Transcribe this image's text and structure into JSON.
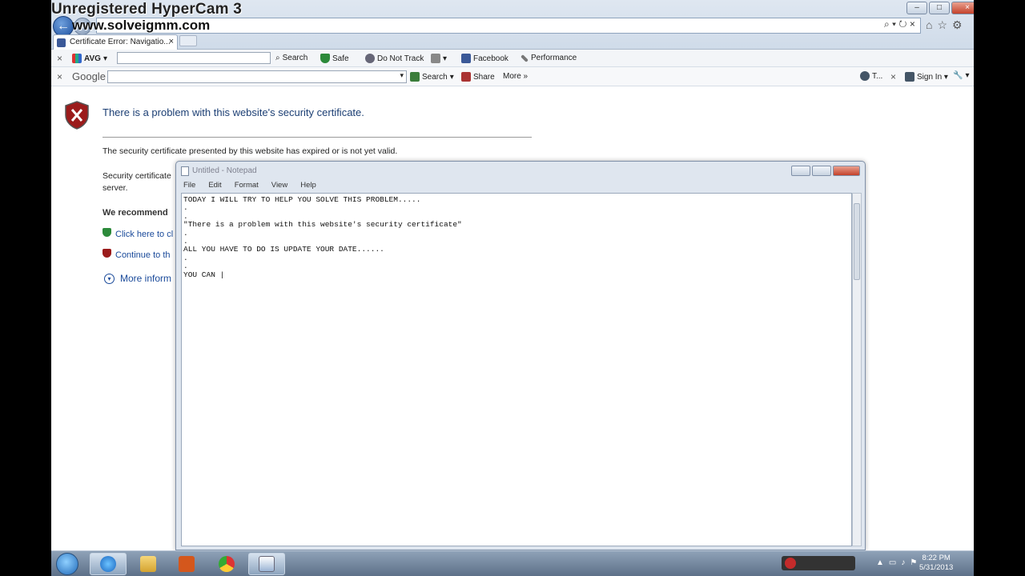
{
  "watermark": {
    "line1": "Unregistered HyperCam 3",
    "line2": "www.solveigmm.com"
  },
  "browser": {
    "tab_title": "Certificate Error: Navigatio...",
    "tab_close": "×",
    "address_tools": "⌕ ▾ ↻ ×",
    "right_icons": [
      "⌂",
      "☆",
      "⚙"
    ]
  },
  "toolbar1": {
    "close": "×",
    "avg_label": "AVG",
    "search": "Search",
    "safe": "Safe",
    "do_not_track": "Do Not Track",
    "facebook": "Facebook",
    "performance": "Performance"
  },
  "toolbar2": {
    "close": "×",
    "google_label": "Google",
    "search": "Search",
    "share": "Share",
    "more": "More »",
    "t_label": "T...",
    "sign_in": "Sign In ▾"
  },
  "page": {
    "title": "There is a problem with this website's security certificate.",
    "text1": "The security certificate presented by this website has expired or is not yet valid.",
    "text2_line1": "Security certificate",
    "text2_line2": "server.",
    "recommend": "We recommend",
    "link1": "Click here to cl",
    "link2": "Continue to th",
    "more_info": "More inform"
  },
  "notepad": {
    "title": "Untitled - Notepad",
    "menu": [
      "File",
      "Edit",
      "Format",
      "View",
      "Help"
    ],
    "content": "TODAY I WILL TRY TO HELP YOU SOLVE THIS PROBLEM.....\n.\n.\n\"There is a problem with this website's security certificate\"\n.\n.\nALL YOU HAVE TO DO IS UPDATE YOUR DATE......\n.\n.\nYOU CAN |"
  },
  "clock": {
    "time": "8:22 PM",
    "date": "5/31/2013"
  },
  "colors": {
    "link": "#1a4a9a",
    "title": "#1c3f74",
    "taskbar": "#5d7088"
  }
}
